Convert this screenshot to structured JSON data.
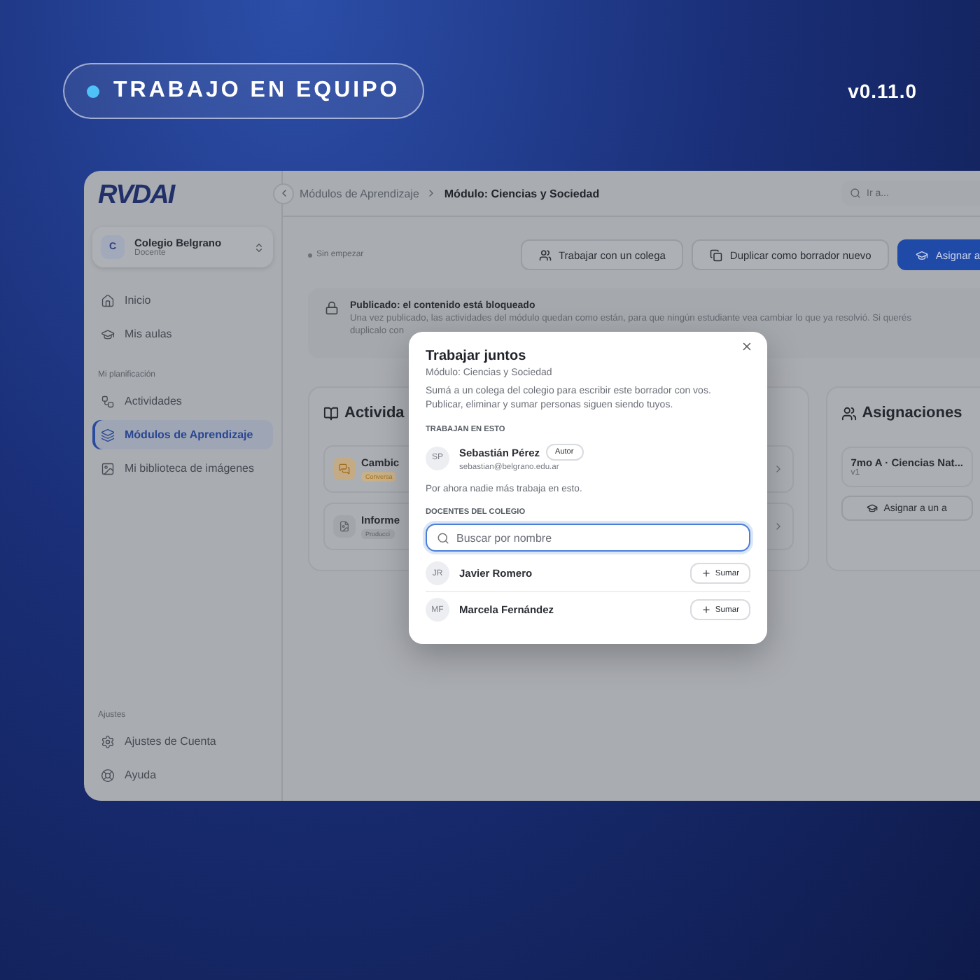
{
  "badge": {
    "label": "TRABAJO EN EQUIPO"
  },
  "version": "v0.11.0",
  "sidebar": {
    "logo": "RVDAI",
    "org": {
      "initial": "C",
      "name": "Colegio Belgrano",
      "role": "Docente"
    },
    "main": [
      {
        "label": "Inicio",
        "selected": false
      },
      {
        "label": "Mis aulas",
        "selected": false
      }
    ],
    "planning_title": "Mi planificación",
    "planning": [
      {
        "label": "Actividades",
        "selected": false
      },
      {
        "label": "Módulos de Aprendizaje",
        "selected": true
      },
      {
        "label": "Mi biblioteca de imágenes",
        "selected": false
      }
    ],
    "settings_title": "Ajustes",
    "settings": [
      {
        "label": "Ajustes de Cuenta",
        "selected": false
      },
      {
        "label": "Ayuda",
        "selected": false
      }
    ]
  },
  "topbar": {
    "breadcrumb": [
      "Módulos de Aprendizaje",
      "Módulo: Ciencias y Sociedad"
    ],
    "search": {
      "placeholder": "Ir a..."
    }
  },
  "status": "Sin empezar",
  "actions": [
    {
      "label": "Trabajar con un colega",
      "kind": "outline"
    },
    {
      "label": "Duplicar como borrador nuevo",
      "kind": "outline"
    },
    {
      "label": "Asignar a",
      "kind": "primary"
    }
  ],
  "notice": {
    "title": "Publicado: el contenido está bloqueado",
    "lines": [
      "Una vez publicado, las actividades del módulo quedan como están, para que ningún estudiante vea cambiar lo que ya resolvió. Si querés",
      "duplicalo con"
    ]
  },
  "activities": {
    "title": "Activida",
    "items": [
      {
        "title": "Cambic",
        "tag": "Conversa",
        "kind": "conversation"
      },
      {
        "title": "Informe",
        "tag": "Producci",
        "kind": "production"
      }
    ]
  },
  "assignments": {
    "title": "Asignaciones",
    "items": [
      {
        "name": "7mo A · Ciencias Nat...",
        "version": "v1"
      }
    ],
    "button": "Asignar a un a"
  },
  "modal": {
    "title": "Trabajar juntos",
    "subtitle": "Módulo: Ciencias y Sociedad",
    "description": "Sumá a un colega del colegio para escribir este borrador con vos. Publicar, eliminar y sumar personas siguen siendo tuyos.",
    "members_title": "TRABAJAN EN ESTO",
    "members": [
      {
        "initials": "SP",
        "name": "Sebastián Pérez",
        "role": "Autor",
        "email": "sebastian@belgrano.edu.ar"
      }
    ],
    "empty_note": "Por ahora nadie más trabaja en esto.",
    "teachers_title": "DOCENTES DEL COLEGIO",
    "search": {
      "placeholder": "Buscar por nombre",
      "focused": true
    },
    "teachers": [
      {
        "initials": "JR",
        "name": "Javier Romero",
        "action": "Sumar"
      },
      {
        "initials": "MF",
        "name": "Marcela Fernández",
        "action": "Sumar"
      }
    ]
  }
}
